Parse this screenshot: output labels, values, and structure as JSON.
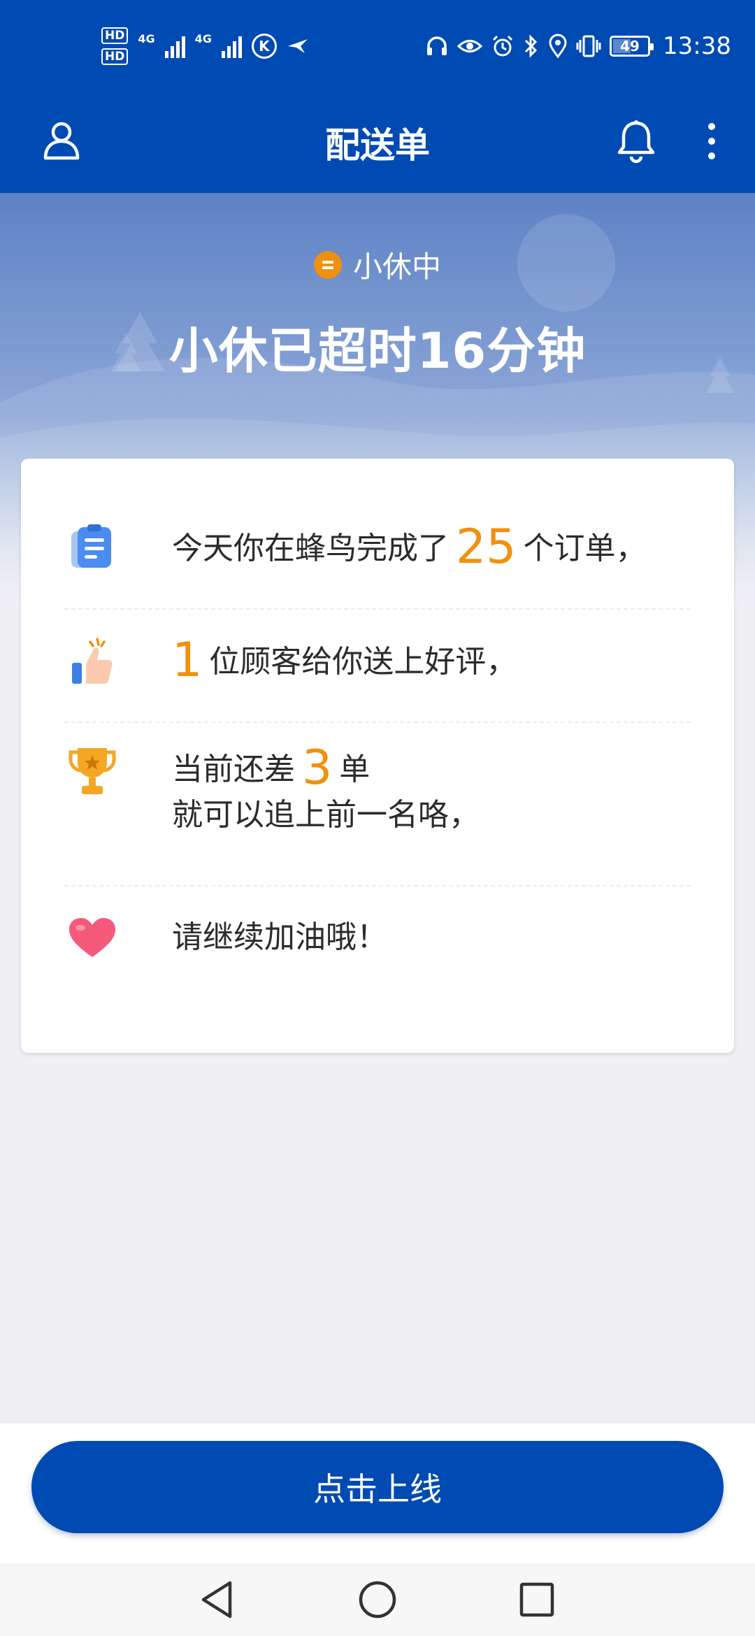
{
  "status_bar": {
    "hd1": "HD",
    "hd2": "HD",
    "net1": "4G",
    "net2": "4G",
    "k_label": "K",
    "battery": "49",
    "time": "13:38"
  },
  "app_bar": {
    "title": "配送单"
  },
  "hero": {
    "status_label": "小休中",
    "headline": "小休已超时16分钟"
  },
  "summary": {
    "orders": {
      "before": "今天你在蜂鸟完成了",
      "count": "25",
      "after": "个订单，"
    },
    "reviews": {
      "count": "1",
      "after": "位顾客给你送上好评，"
    },
    "rank": {
      "before": "当前还差",
      "count": "3",
      "after": "单",
      "line2": "就可以追上前一名咯，"
    },
    "cheer": {
      "text": "请继续加油哦！"
    }
  },
  "bottom": {
    "online_button": "点击上线"
  },
  "colors": {
    "primary": "#004ab3",
    "accent": "#f1900e",
    "heart": "#f65a7a"
  },
  "icons": [
    "user-icon",
    "bell-icon",
    "more-vertical-icon",
    "clipboard-icon",
    "thumbs-up-icon",
    "trophy-icon",
    "heart-icon"
  ]
}
